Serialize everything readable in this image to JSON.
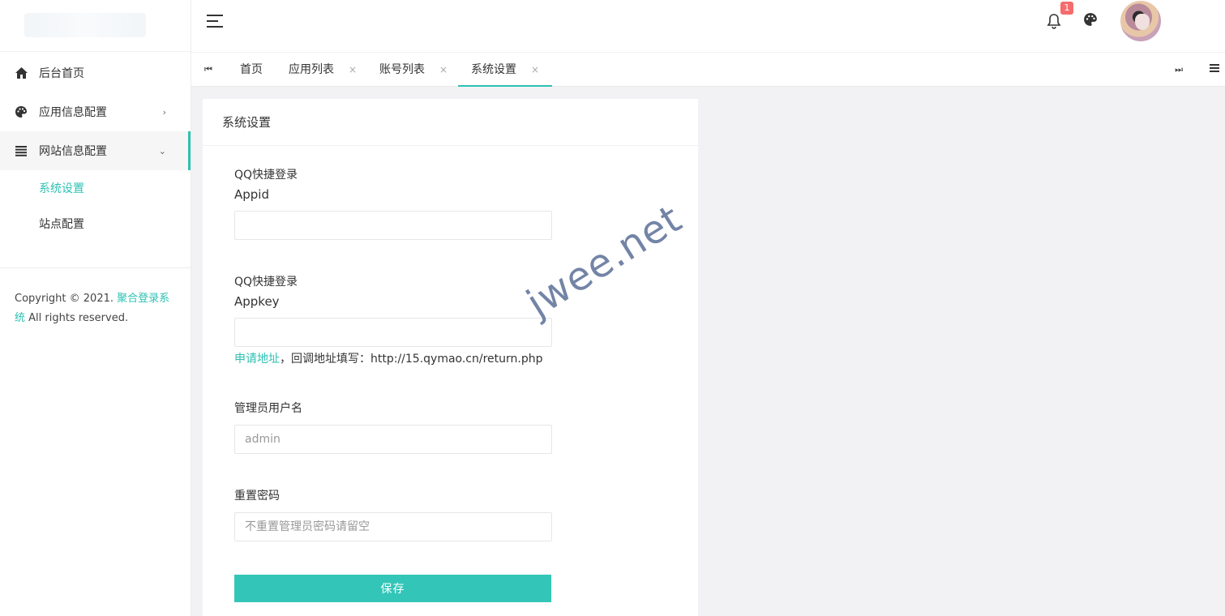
{
  "sidebar": {
    "items": [
      {
        "label": "后台首页",
        "icon": "home-icon"
      },
      {
        "label": "应用信息配置",
        "icon": "palette-icon",
        "arrow": "›"
      },
      {
        "label": "网站信息配置",
        "icon": "list-icon",
        "arrow": "⌄"
      }
    ],
    "subitems": [
      {
        "label": "系统设置",
        "active": true
      },
      {
        "label": "站点配置",
        "active": false
      }
    ],
    "footer": {
      "copyright": "Copyright © 2021.",
      "link": "聚合登录系统",
      "rights": "All rights reserved."
    }
  },
  "header": {
    "notification_count": "1"
  },
  "tabs": {
    "items": [
      {
        "label": "首页",
        "closable": false
      },
      {
        "label": "应用列表",
        "closable": true
      },
      {
        "label": "账号列表",
        "closable": true
      },
      {
        "label": "系统设置",
        "closable": true,
        "active": true
      }
    ],
    "close_glyph": "×"
  },
  "card": {
    "title": "系统设置",
    "fields": {
      "appid_label_1": "QQ快捷登录",
      "appid_label_2": "Appid",
      "appid_value": "",
      "appkey_label_1": "QQ快捷登录",
      "appkey_label_2": "Appkey",
      "appkey_value": "",
      "hint_link": "申请地址",
      "hint_text": "，回调地址填写：http://15.qymao.cn/return.php",
      "username_label": "管理员用户名",
      "username_placeholder": "admin",
      "password_label": "重置密码",
      "password_placeholder": "不重置管理员密码请留空"
    },
    "save_label": "保存"
  },
  "watermark": "jwee.net",
  "colors": {
    "accent": "#2ec1b3",
    "badge": "#f56c6c"
  }
}
